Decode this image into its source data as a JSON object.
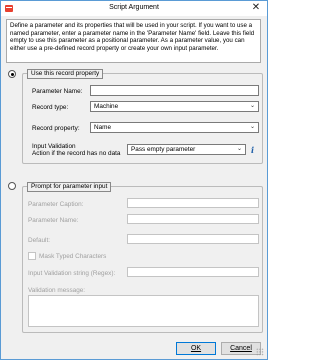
{
  "window": {
    "title": "Script Argument",
    "close_glyph": "✕"
  },
  "description": "Define a parameter and its properties that will be used in your script. If you want to use a named parameter, enter a parameter name in the 'Parameter Name' field. Leave this field empty to use this parameter as a positional parameter. As a parameter value, you can either use a pre-defined record property or create your own input parameter.",
  "record_group": {
    "legend": "Use this record property",
    "selected": true,
    "param_name_label": "Parameter Name:",
    "param_name_value": "",
    "record_type_label": "Record type:",
    "record_type_value": "Machine",
    "record_property_label": "Record property:",
    "record_property_value": "Name",
    "input_validation_label": "Input Validation",
    "action_label": "Action if the record has no data",
    "action_value": "Pass empty parameter",
    "info_glyph": "i",
    "dropdown_glyph": "⌄"
  },
  "prompt_group": {
    "legend": "Prompt for parameter input",
    "selected": false,
    "caption_label": "Parameter Caption:",
    "name_label": "Parameter Name:",
    "default_label": "Default:",
    "mask_label": "Mask Typed Characters",
    "validation_string_label": "Input Validation string (Regex):",
    "validation_message_label": "Validation message:"
  },
  "buttons": {
    "ok_label": "OK",
    "cancel_label": "Cancel"
  },
  "icons": {
    "app": "app-logo-icon",
    "close": "close-icon",
    "info": "info-icon",
    "dropdown": "chevron-down-icon",
    "grip": "resize-grip-icon"
  },
  "colors": {
    "accent": "#0078d7",
    "border": "#5a9bd5",
    "app_icon": "#e8402f"
  }
}
